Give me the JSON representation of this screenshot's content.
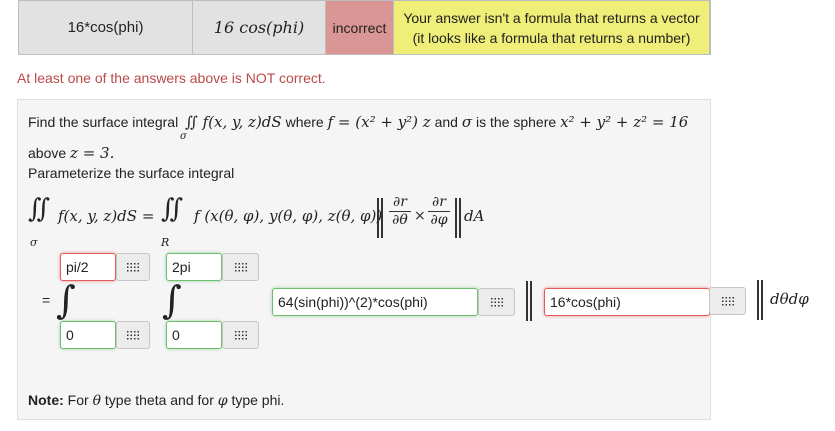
{
  "results": {
    "entered": "16*cos(phi)",
    "preview": "16 cos(phi)",
    "result": "incorrect",
    "message_line1": "Your answer isn't a formula that returns a vector",
    "message_line2": "(it looks like a formula that returns a number)"
  },
  "warning": "At least one of the answers above is NOT correct.",
  "problem": {
    "line1_find": "Find the surface integral",
    "line1_where": "where",
    "line1_and": "and",
    "line1_is": "is the sphere",
    "line2_above": "above",
    "line2_cond": "z = 3.",
    "line3": "Parameterize the surface integral",
    "equals": "=",
    "note_label": "Note:",
    "note_for1": "For",
    "note_theta": "θ",
    "note_text1": "type theta and for",
    "note_phi": "φ",
    "note_text2": "type phi."
  },
  "inputs": {
    "upper1": "pi/2",
    "upper2": "2pi",
    "lower1": "0",
    "lower2": "0",
    "integrand": "64(sin(phi))^(2)*cos(phi)",
    "cross": "16*cos(phi)"
  },
  "differential": "dθdφ",
  "colors": {
    "incorrect": "#d99694",
    "message": "#eeee78",
    "warning": "#b94a48"
  }
}
